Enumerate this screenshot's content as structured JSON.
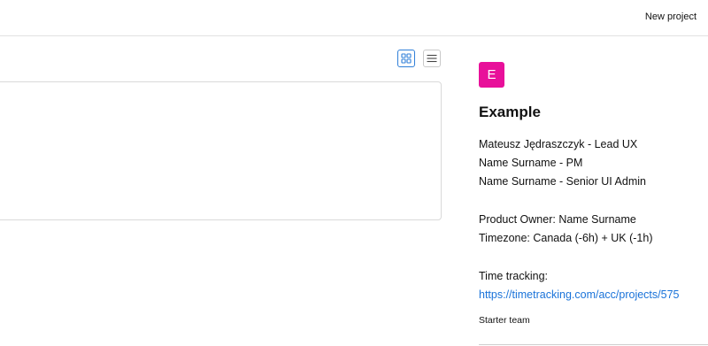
{
  "header": {
    "new_project_label": "New project"
  },
  "toolbar": {
    "grid_view_icon": "grid-icon",
    "list_view_icon": "list-icon",
    "active_view": "grid"
  },
  "project": {
    "avatar_letter": "E",
    "avatar_color": "#e8109a",
    "title": "Example",
    "team_members": [
      "Mateusz Jędraszczyk - Lead UX",
      "Name Surname - PM",
      "Name Surname - Senior UI Admin"
    ],
    "product_owner": "Product Owner: Name Surname",
    "timezone": "Timezone: Canada (-6h) + UK (-1h)",
    "time_tracking_label": "Time tracking:",
    "time_tracking_url": "https://timetracking.com/acc/projects/575",
    "team_name": "Starter team"
  },
  "colors": {
    "accent": "#2f7fd8",
    "link": "#1a73d9"
  }
}
